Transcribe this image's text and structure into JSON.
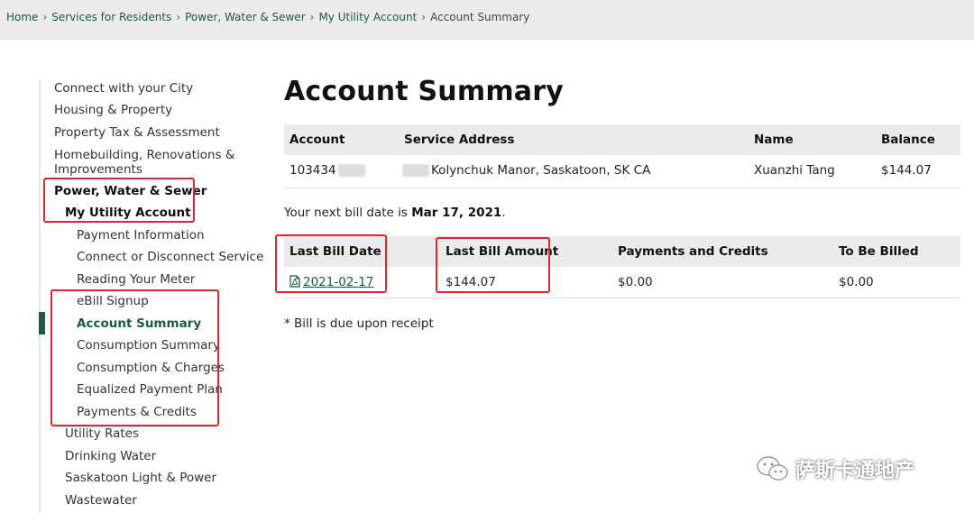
{
  "breadcrumb": {
    "items": [
      "Home",
      "Services for Residents",
      "Power, Water & Sewer",
      "My Utility Account",
      "Account Summary"
    ],
    "separator": "›"
  },
  "sidebar": {
    "items": [
      {
        "label": "Connect with your City"
      },
      {
        "label": "Housing & Property"
      },
      {
        "label": "Property Tax & Assessment"
      },
      {
        "label": "Homebuilding, Renovations & Improvements"
      },
      {
        "label": "Power, Water & Sewer"
      },
      {
        "label": "My Utility Account"
      },
      {
        "label": "Payment Information"
      },
      {
        "label": "Connect or Disconnect Service"
      },
      {
        "label": "Reading Your Meter"
      },
      {
        "label": "eBill Signup"
      },
      {
        "label": "Account Summary"
      },
      {
        "label": "Consumption Summary"
      },
      {
        "label": "Consumption & Charges"
      },
      {
        "label": "Equalized Payment Plan"
      },
      {
        "label": "Payments & Credits"
      },
      {
        "label": "Utility Rates"
      },
      {
        "label": "Drinking Water"
      },
      {
        "label": "Saskatoon Light & Power"
      },
      {
        "label": "Wastewater"
      }
    ]
  },
  "main": {
    "title": "Account Summary",
    "account_table": {
      "headers": [
        "Account",
        "Service Address",
        "Name",
        "Balance"
      ],
      "row": {
        "account": "103434",
        "service_address": "Kolynchuk Manor, Saskatoon, SK CA",
        "name": "Xuanzhi Tang",
        "balance": "$144.07"
      }
    },
    "next_bill": {
      "prefix": "Your next bill date is ",
      "date": "Mar 17, 2021",
      "suffix": "."
    },
    "bill_table": {
      "headers": [
        "Last Bill Date",
        "Last Bill Amount",
        "Payments and Credits",
        "To Be Billed"
      ],
      "row": {
        "last_bill_date": "2021-02-17",
        "last_bill_amount": "$144.07",
        "payments_and_credits": "$0.00",
        "to_be_billed": "$0.00"
      }
    },
    "footnote": "* Bill is due upon receipt"
  },
  "watermark": {
    "text": "萨斯卡通地产",
    "icon": "wechat-icon"
  },
  "colors": {
    "brand_green": "#1e5a46",
    "highlight_red": "#e2262c",
    "header_gray": "#ebebeb"
  }
}
